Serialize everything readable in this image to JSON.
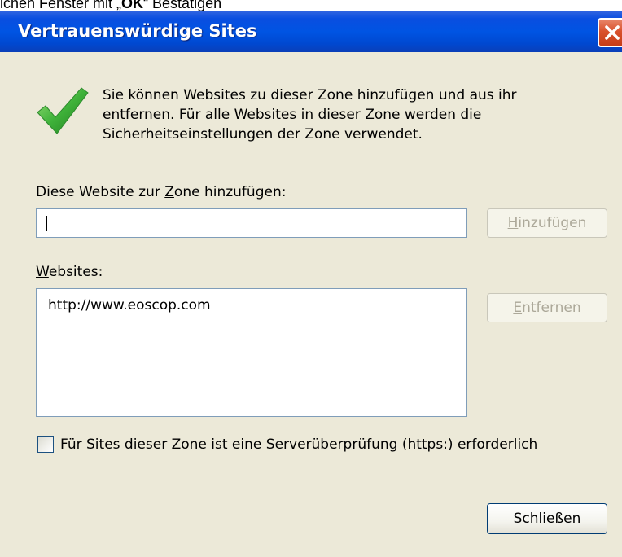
{
  "caption": {
    "text_prefix": "ichen Fenster mit „",
    "text_bold": "OK",
    "text_suffix": "“ Bestätigen"
  },
  "window": {
    "title": "Vertrauenswürdige Sites",
    "close_icon": "close-icon",
    "title_color": "#0054e3",
    "close_color": "#d9512c"
  },
  "info": {
    "icon": "checkmark-icon",
    "text": "Sie können Websites zu dieser Zone hinzufügen und aus ihr entfernen. Für alle Websites in dieser Zone werden die Sicherheitseinstellungen der Zone verwendet."
  },
  "add_site": {
    "label_before": "Diese Website zur ",
    "label_underlined": "Z",
    "label_after": "one hinzufügen:",
    "input_value": "",
    "button_underlined": "H",
    "button_rest": "inzufügen"
  },
  "websites": {
    "label_underlined": "W",
    "label_rest": "ebsites:",
    "items": [
      "http://www.eoscop.com"
    ],
    "remove_button_underlined": "E",
    "remove_button_rest": "ntfernen"
  },
  "server_check": {
    "label_before": "Für Sites dieser Zone ist eine ",
    "label_underlined": "S",
    "label_after": "erverüberprüfung (https:) erforderlich",
    "checked": false
  },
  "close_button": {
    "label_before": "S",
    "label_underlined": "c",
    "label_after": "hließen"
  }
}
